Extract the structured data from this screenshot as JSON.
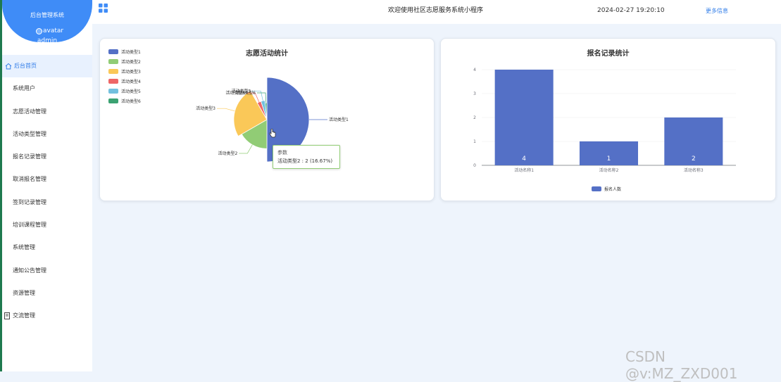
{
  "sidebar": {
    "title": "后台管理系统",
    "avatar_alt": "avatar",
    "username": "admin",
    "items": [
      {
        "label": "后台首页",
        "active": true
      },
      {
        "label": "系统用户"
      },
      {
        "label": "志愿活动管理"
      },
      {
        "label": "活动类型管理"
      },
      {
        "label": "报名记录管理"
      },
      {
        "label": "取消报名管理"
      },
      {
        "label": "签到记录管理"
      },
      {
        "label": "培训课程管理"
      },
      {
        "label": "系统管理"
      },
      {
        "label": "通知公告管理"
      },
      {
        "label": "资源管理"
      },
      {
        "label": "交流管理"
      }
    ]
  },
  "header": {
    "welcome": "欢迎使用社区志愿服务系统小程序",
    "datetime": "2024-02-27 19:20:10",
    "more_info": "更多信息"
  },
  "colors": {
    "accent": "#3f8cf7",
    "bar": "#5470c6"
  },
  "chart_data": [
    {
      "type": "pie",
      "title": "志愿活动统计",
      "legend_placement": "top-left",
      "slices": [
        {
          "name": "活动类型1",
          "value": 6,
          "color": "#5470c6"
        },
        {
          "name": "活动类型2",
          "value": 2,
          "color": "#91cc75"
        },
        {
          "name": "活动类型3",
          "value": 3,
          "color": "#fac858"
        },
        {
          "name": "活动类型4",
          "value": 0.4,
          "color": "#ee6666"
        },
        {
          "name": "活动类型5",
          "value": 0.4,
          "color": "#73c0de"
        },
        {
          "name": "活动类型6",
          "value": 0.2,
          "color": "#3ba272"
        }
      ],
      "tooltip": {
        "title": "参数",
        "text": "活动类型2 : 2 (16.67%)"
      }
    },
    {
      "type": "bar",
      "title": "报名记录统计",
      "categories": [
        "活动名称1",
        "活动名称2",
        "活动名称3"
      ],
      "series": [
        {
          "name": "报名人数",
          "values": [
            4,
            1,
            2
          ]
        }
      ],
      "ylim": [
        0,
        4
      ],
      "yticks": [
        "0",
        "1",
        "2",
        "3",
        "4"
      ],
      "legend_placement": "bottom-center"
    }
  ],
  "watermark": "CSDN @v:MZ_ZXD001"
}
